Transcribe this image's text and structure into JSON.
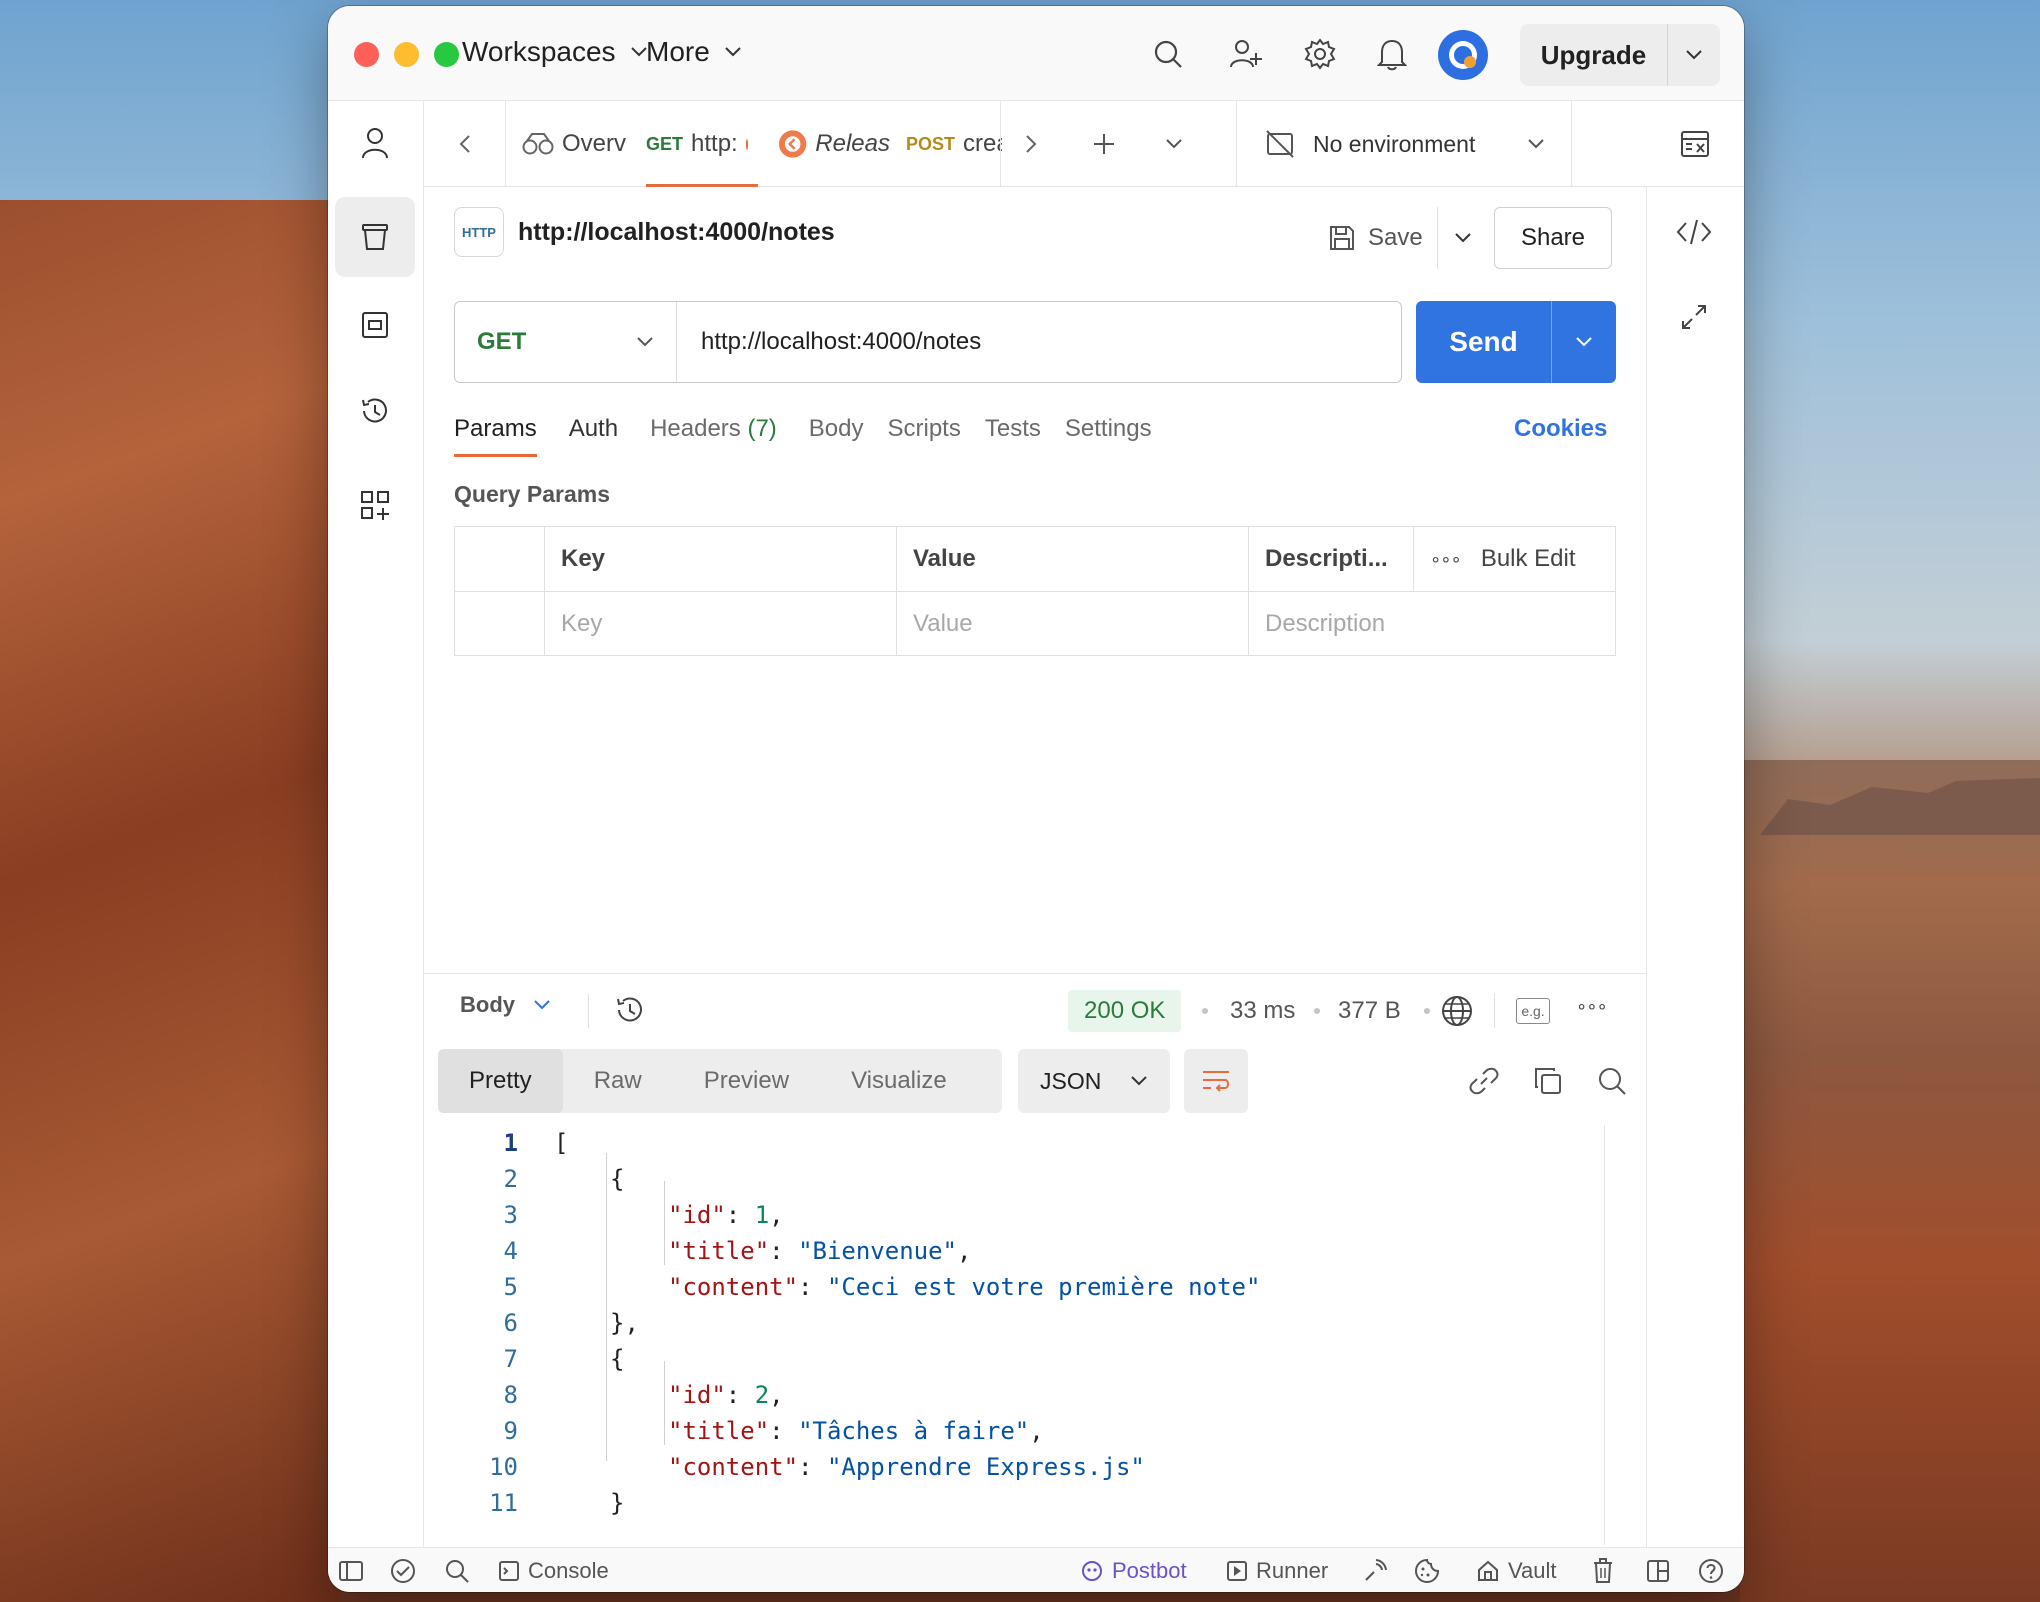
{
  "titlebar": {
    "menu_workspaces": "Workspaces",
    "menu_more": "More",
    "upgrade_label": "Upgrade"
  },
  "tabs": [
    {
      "method": "",
      "label": "Overv",
      "icon": "binoculars-icon"
    },
    {
      "method": "GET",
      "label": "http:",
      "unsaved": true,
      "active": true
    },
    {
      "method": "",
      "label": "Releas",
      "icon": "release-icon"
    },
    {
      "method": "POST",
      "label": "crea"
    }
  ],
  "environment": {
    "label": "No environment"
  },
  "request": {
    "title": "http://localhost:4000/notes",
    "save_label": "Save",
    "share_label": "Share",
    "method": "GET",
    "url": "http://localhost:4000/notes",
    "send_label": "Send",
    "tabs": [
      "Params",
      "Auth",
      "Headers",
      "Body",
      "Scripts",
      "Tests",
      "Settings"
    ],
    "headers_count": "(7)",
    "cookies_label": "Cookies",
    "query_params_label": "Query Params",
    "table": {
      "headers": [
        "Key",
        "Value",
        "Descripti...",
        "Bulk Edit"
      ],
      "placeholders": [
        "Key",
        "Value",
        "Description"
      ]
    }
  },
  "response": {
    "body_label": "Body",
    "status": "200 OK",
    "time": "33 ms",
    "size": "377 B",
    "eg_label": "e.g.",
    "views": [
      "Pretty",
      "Raw",
      "Preview",
      "Visualize"
    ],
    "format": "JSON",
    "line_numbers": [
      "1",
      "2",
      "3",
      "4",
      "5",
      "6",
      "7",
      "8",
      "9",
      "10",
      "11"
    ],
    "json": [
      {
        "id": 1,
        "title": "Bienvenue",
        "content": "Ceci est votre première note"
      },
      {
        "id": 2,
        "title": "Tâches à faire",
        "content": "Apprendre Express.js"
      }
    ],
    "keys": {
      "id": "\"id\"",
      "title": "\"title\"",
      "content": "\"content\""
    },
    "values": {
      "id1": "1",
      "title1": "\"Bienvenue\"",
      "content1": "\"Ceci est votre première note\"",
      "id2": "2",
      "title2": "\"Tâches à faire\"",
      "content2": "\"Apprendre Express.js\""
    }
  },
  "statusbar": {
    "console": "Console",
    "postbot": "Postbot",
    "runner": "Runner",
    "vault": "Vault"
  },
  "colors": {
    "accent": "#e96a3a",
    "primary": "#2f74e0",
    "get_method": "#2c7a3c",
    "post_method": "#b48a1a",
    "status_ok_bg": "#e7f5ea"
  }
}
